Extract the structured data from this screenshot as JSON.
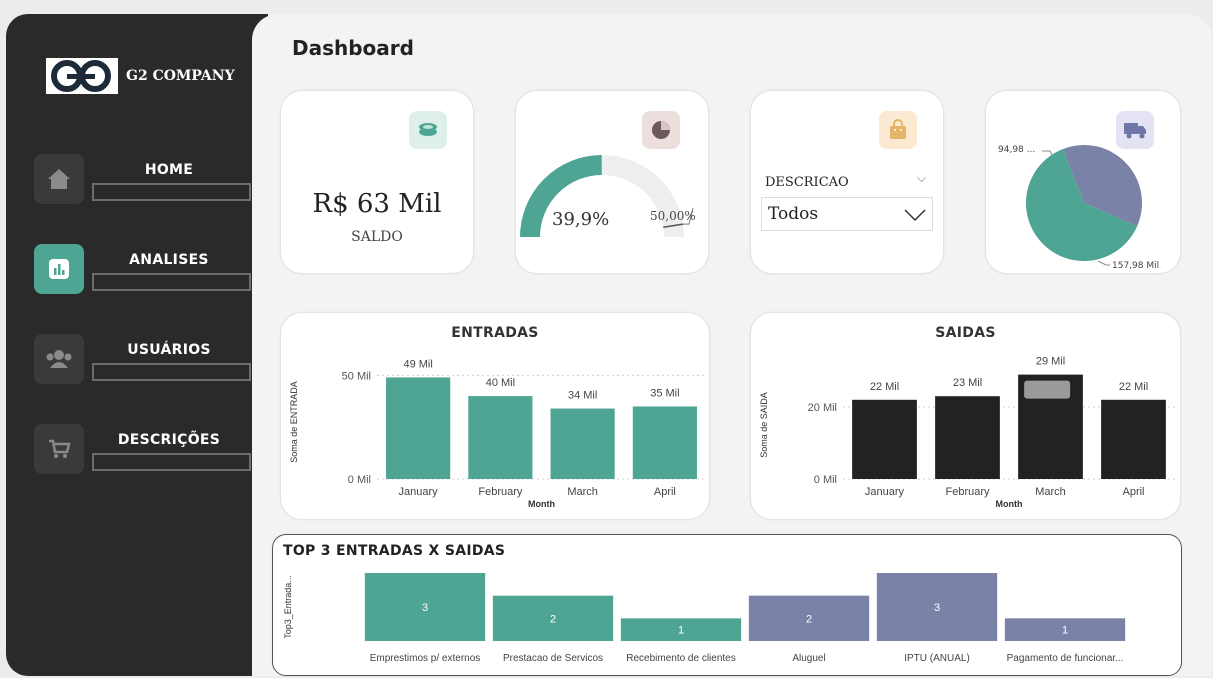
{
  "brand": {
    "name": "G2 COMPANY",
    "mark": "G2"
  },
  "nav": [
    {
      "label": "HOME",
      "icon": "home-icon"
    },
    {
      "label": "ANALISES",
      "icon": "bar-chart-icon"
    },
    {
      "label": "USUÁRIOS",
      "icon": "users-icon"
    },
    {
      "label": "DESCRIÇÕES",
      "icon": "cart-icon"
    }
  ],
  "page": {
    "title": "Dashboard"
  },
  "kpi": {
    "value": "R$ 63 Mil",
    "label": "SALDO",
    "icon": "coins-icon"
  },
  "gauge": {
    "value_text": "39,9%",
    "target_text": "50,00%",
    "value": 0.399,
    "target": 0.5,
    "icon": "pie-chart-icon"
  },
  "filter": {
    "label": "DESCRICAO",
    "selected": "Todos",
    "icon": "bag-icon"
  },
  "pie": {
    "icon": "truck-icon",
    "label_a": "94,98 ...",
    "label_b": "157,98 Mil",
    "slices": [
      {
        "value": 94.98,
        "color": "#7b82a8"
      },
      {
        "value": 157.98,
        "color": "#4ea593"
      }
    ]
  },
  "chart_data": [
    {
      "type": "bar",
      "title": "ENTRADAS",
      "xlabel": "Month",
      "ylabel": "Soma de ENTRADA",
      "categories": [
        "January",
        "February",
        "March",
        "April"
      ],
      "values": [
        49,
        40,
        34,
        35
      ],
      "value_labels": [
        "49 Mil",
        "40 Mil",
        "34 Mil",
        "35 Mil"
      ],
      "ticks": [
        "0 Mil",
        "50 Mil"
      ],
      "ylim": [
        0,
        55
      ],
      "color": "#4ea593"
    },
    {
      "type": "bar",
      "title": "SAIDAS",
      "xlabel": "Month",
      "ylabel": "Soma de SAIDA",
      "categories": [
        "January",
        "February",
        "March",
        "April"
      ],
      "values": [
        22,
        23,
        29,
        22
      ],
      "value_labels": [
        "22 Mil",
        "23 Mil",
        "29 Mil",
        "22 Mil"
      ],
      "ticks": [
        "0 Mil",
        "20 Mil"
      ],
      "ylim": [
        0,
        30
      ],
      "color": "#222222"
    },
    {
      "type": "bar",
      "title": "TOP 3 ENTRADAS X SAIDAS",
      "ylabel": "Top3_Entrada...",
      "categories": [
        "Emprestimos p/ externos",
        "Prestacao de Servicos",
        "Recebimento de clientes",
        "Aluguel",
        "IPTU (ANUAL)",
        "Pagamento de funcionar..."
      ],
      "values": [
        3,
        2,
        1,
        2,
        3,
        1
      ],
      "colors": [
        "#4ea593",
        "#4ea593",
        "#4ea593",
        "#7b82a8",
        "#7b82a8",
        "#7b82a8"
      ],
      "ylim": [
        0,
        3
      ]
    }
  ]
}
